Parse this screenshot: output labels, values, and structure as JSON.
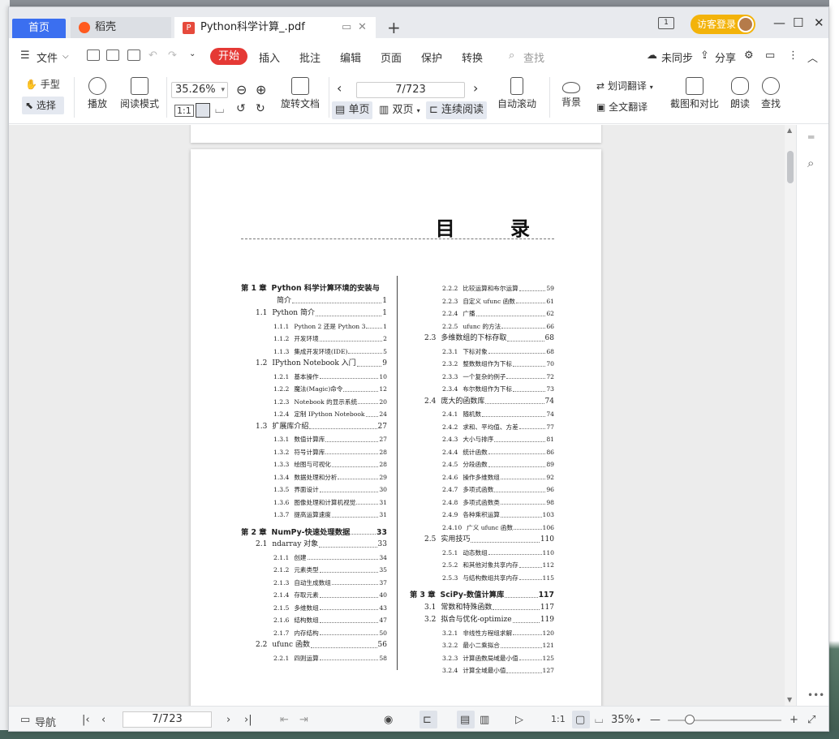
{
  "tabs": {
    "home": "首页",
    "docer": "稻壳",
    "document": "Python科学计算_.pdf",
    "add": "+"
  },
  "account": {
    "guest_login": "访客登录"
  },
  "menu": {
    "file": "文件",
    "start": "开始",
    "insert": "插入",
    "annotate": "批注",
    "edit": "编辑",
    "page": "页面",
    "protect": "保护",
    "convert": "转换",
    "search": "查找",
    "unsynced": "未同步",
    "share": "分享"
  },
  "toolbar": {
    "hand": "手型",
    "select": "选择",
    "play": "播放",
    "reading_mode": "阅读模式",
    "zoom_value": "35.26%",
    "rotate": "旋转文档",
    "page_value": "7/723",
    "single": "单页",
    "double": "双页",
    "continuous": "连续阅读",
    "auto_scroll": "自动滚动",
    "background": "背景",
    "word_translate": "划词翻译",
    "full_translate": "全文翻译",
    "screenshot_compare": "截图和对比",
    "read_aloud": "朗读",
    "find": "查找"
  },
  "document": {
    "title": "目 录",
    "left_column": [
      {
        "level": "ch",
        "num": "第 1 章",
        "text": "Python 科学计算环境的安装与",
        "page": ""
      },
      {
        "level": "cont",
        "num": "",
        "text": "简介",
        "page": "1"
      },
      {
        "level": "sec",
        "num": "1.1",
        "text": "Python 简介",
        "page": "1"
      },
      {
        "level": "sub",
        "num": "1.1.1",
        "text": "Python 2 还是 Python 3",
        "page": "1"
      },
      {
        "level": "sub",
        "num": "1.1.2",
        "text": "开发环境",
        "page": "2"
      },
      {
        "level": "sub",
        "num": "1.1.3",
        "text": "集成开发环境(IDE)",
        "page": "5"
      },
      {
        "level": "sec",
        "num": "1.2",
        "text": "IPython Notebook 入门",
        "page": "9"
      },
      {
        "level": "sub",
        "num": "1.2.1",
        "text": "基本操作",
        "page": "10"
      },
      {
        "level": "sub",
        "num": "1.2.2",
        "text": "魔法(Magic)命令",
        "page": "12"
      },
      {
        "level": "sub",
        "num": "1.2.3",
        "text": "Notebook 的显示系统",
        "page": "20"
      },
      {
        "level": "sub",
        "num": "1.2.4",
        "text": "定制 IPython Notebook",
        "page": "24"
      },
      {
        "level": "sec",
        "num": "1.3",
        "text": "扩展库介绍",
        "page": "27"
      },
      {
        "level": "sub",
        "num": "1.3.1",
        "text": "数值计算库",
        "page": "27"
      },
      {
        "level": "sub",
        "num": "1.3.2",
        "text": "符号计算库",
        "page": "28"
      },
      {
        "level": "sub",
        "num": "1.3.3",
        "text": "绘图与可视化",
        "page": "28"
      },
      {
        "level": "sub",
        "num": "1.3.4",
        "text": "数据处理和分析",
        "page": "29"
      },
      {
        "level": "sub",
        "num": "1.3.5",
        "text": "界面设计",
        "page": "30"
      },
      {
        "level": "sub",
        "num": "1.3.6",
        "text": "图像处理和计算机视觉",
        "page": "31"
      },
      {
        "level": "sub",
        "num": "1.3.7",
        "text": "提高运算速度",
        "page": "31"
      },
      {
        "level": "ch",
        "num": "第 2 章",
        "text": "NumPy-快速处理数据",
        "page": "33"
      },
      {
        "level": "sec",
        "num": "2.1",
        "text": "ndarray 对象",
        "page": "33"
      },
      {
        "level": "sub",
        "num": "2.1.1",
        "text": "创建",
        "page": "34"
      },
      {
        "level": "sub",
        "num": "2.1.2",
        "text": "元素类型",
        "page": "35"
      },
      {
        "level": "sub",
        "num": "2.1.3",
        "text": "自动生成数组",
        "page": "37"
      },
      {
        "level": "sub",
        "num": "2.1.4",
        "text": "存取元素",
        "page": "40"
      },
      {
        "level": "sub",
        "num": "2.1.5",
        "text": "多维数组",
        "page": "43"
      },
      {
        "level": "sub",
        "num": "2.1.6",
        "text": "结构数组",
        "page": "47"
      },
      {
        "level": "sub",
        "num": "2.1.7",
        "text": "内存结构",
        "page": "50"
      },
      {
        "level": "sec",
        "num": "2.2",
        "text": "ufunc 函数",
        "page": "56"
      },
      {
        "level": "sub",
        "num": "2.2.1",
        "text": "四则运算",
        "page": "58"
      }
    ],
    "right_column": [
      {
        "level": "sub",
        "num": "2.2.2",
        "text": "比较运算和布尔运算",
        "page": "59"
      },
      {
        "level": "sub",
        "num": "2.2.3",
        "text": "自定义 ufunc 函数",
        "page": "61"
      },
      {
        "level": "sub",
        "num": "2.2.4",
        "text": "广播",
        "page": "62"
      },
      {
        "level": "sub",
        "num": "2.2.5",
        "text": "ufunc 的方法",
        "page": "66"
      },
      {
        "level": "sec",
        "num": "2.3",
        "text": "多维数组的下标存取",
        "page": "68"
      },
      {
        "level": "sub",
        "num": "2.3.1",
        "text": "下标对象",
        "page": "68"
      },
      {
        "level": "sub",
        "num": "2.3.2",
        "text": "整数数组作为下标",
        "page": "70"
      },
      {
        "level": "sub",
        "num": "2.3.3",
        "text": "一个复杂的例子",
        "page": "72"
      },
      {
        "level": "sub",
        "num": "2.3.4",
        "text": "布尔数组作为下标",
        "page": "73"
      },
      {
        "level": "sec",
        "num": "2.4",
        "text": "庞大的函数库",
        "page": "74"
      },
      {
        "level": "sub",
        "num": "2.4.1",
        "text": "随机数",
        "page": "74"
      },
      {
        "level": "sub",
        "num": "2.4.2",
        "text": "求和、平均值、方差",
        "page": "77"
      },
      {
        "level": "sub",
        "num": "2.4.3",
        "text": "大小与排序",
        "page": "81"
      },
      {
        "level": "sub",
        "num": "2.4.4",
        "text": "统计函数",
        "page": "86"
      },
      {
        "level": "sub",
        "num": "2.4.5",
        "text": "分段函数",
        "page": "89"
      },
      {
        "level": "sub",
        "num": "2.4.6",
        "text": "操作多维数组",
        "page": "92"
      },
      {
        "level": "sub",
        "num": "2.4.7",
        "text": "多项式函数",
        "page": "96"
      },
      {
        "level": "sub",
        "num": "2.4.8",
        "text": "多项式函数类",
        "page": "98"
      },
      {
        "level": "sub",
        "num": "2.4.9",
        "text": "各种乘积运算",
        "page": "103"
      },
      {
        "level": "sub",
        "num": "2.4.10",
        "text": "广义 ufunc 函数",
        "page": "106"
      },
      {
        "level": "sec",
        "num": "2.5",
        "text": "实用技巧",
        "page": "110"
      },
      {
        "level": "sub",
        "num": "2.5.1",
        "text": "动态数组",
        "page": "110"
      },
      {
        "level": "sub",
        "num": "2.5.2",
        "text": "和其他对象共享内存",
        "page": "112"
      },
      {
        "level": "sub",
        "num": "2.5.3",
        "text": "与结构数组共享内存",
        "page": "115"
      },
      {
        "level": "ch",
        "num": "第 3 章",
        "text": "SciPy-数值计算库",
        "page": "117"
      },
      {
        "level": "sec",
        "num": "3.1",
        "text": "常数和特殊函数",
        "page": "117"
      },
      {
        "level": "sec",
        "num": "3.2",
        "text": "拟合与优化-optimize",
        "page": "119"
      },
      {
        "level": "sub",
        "num": "3.2.1",
        "text": "非线性方程组求解",
        "page": "120"
      },
      {
        "level": "sub",
        "num": "3.2.2",
        "text": "最小二乘拟合",
        "page": "121"
      },
      {
        "level": "sub",
        "num": "3.2.3",
        "text": "计算函数局域最小值",
        "page": "125"
      },
      {
        "level": "sub",
        "num": "3.2.4",
        "text": "计算全域最小值",
        "page": "127"
      }
    ]
  },
  "statusbar": {
    "navigation": "导航",
    "page_value": "7/723",
    "zoom": "35%"
  }
}
